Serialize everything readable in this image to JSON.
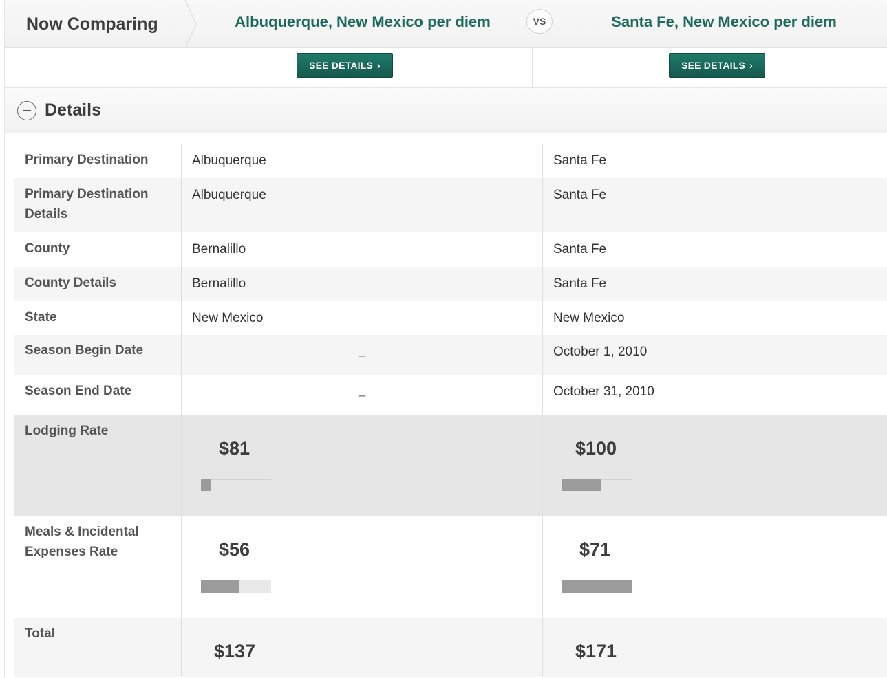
{
  "header": {
    "now_comparing": "Now Comparing",
    "place_a": "Albuquerque, New Mexico per diem",
    "place_b": "Santa Fe, New Mexico per diem",
    "vs": "VS"
  },
  "buttons": {
    "see_details_a": "SEE DETAILS",
    "see_details_b": "SEE DETAILS",
    "chevron": "›"
  },
  "details": {
    "title": "Details",
    "collapse_icon": "minus-circle-icon"
  },
  "rows": [
    {
      "label": "Primary Destination",
      "a": "Albuquerque",
      "b": "Santa Fe"
    },
    {
      "label": "Primary Destination Details",
      "a": "Albuquerque",
      "b": "Santa Fe"
    },
    {
      "label": "County",
      "a": "Bernalillo",
      "b": "Santa Fe"
    },
    {
      "label": "County Details",
      "a": "Bernalillo",
      "b": "Santa Fe"
    },
    {
      "label": "State",
      "a": "New Mexico",
      "b": "New Mexico"
    },
    {
      "label": "Season Begin Date",
      "a": "–",
      "b": "October 1, 2010"
    },
    {
      "label": "Season End Date",
      "a": "–",
      "b": "October 31, 2010"
    }
  ],
  "rates": {
    "lodging": {
      "label": "Lodging Rate",
      "a": "$81",
      "b": "$100",
      "a_fill": 0.14,
      "b_fill": 0.55
    },
    "meals": {
      "label": "Meals & Incidental Expenses Rate",
      "a": "$56",
      "b": "$71",
      "a_fill": 0.54,
      "b_fill": 1.0
    },
    "total": {
      "label": "Total",
      "a": "$137",
      "b": "$171"
    }
  },
  "colors": {
    "accent": "#1b6b5c",
    "button": "#1a6b5d",
    "bar": "#9b9b9b"
  }
}
